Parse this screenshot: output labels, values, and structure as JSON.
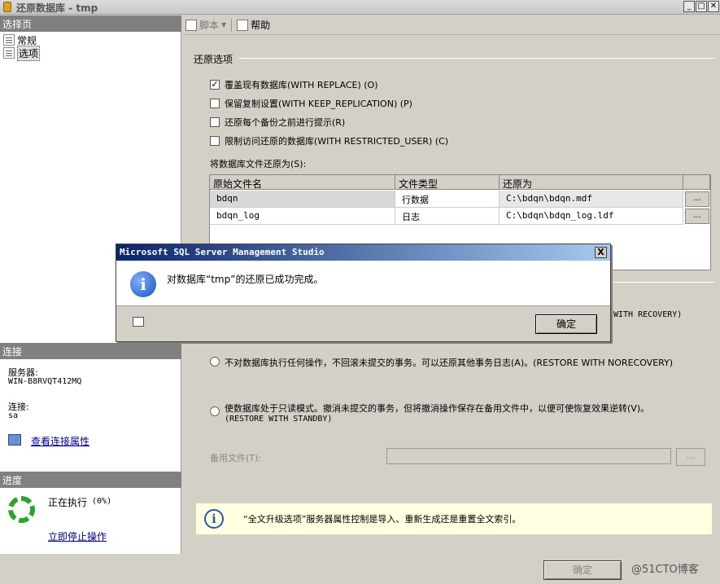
{
  "window": {
    "title": "还原数据库 - tmp"
  },
  "left": {
    "select_page_header": "选择页",
    "nav": [
      {
        "label": "常规"
      },
      {
        "label": "选项"
      }
    ],
    "connection_header": "连接",
    "server_label": "服务器:",
    "server_value": "WIN-B8RVQT412MQ",
    "conn_label": "连接:",
    "conn_value": "sa",
    "view_conn_link": "查看连接属性",
    "progress_header": "进度",
    "progress_status": "正在执行",
    "progress_pct": "(0%)",
    "stop_link": "立即停止操作"
  },
  "toolbar": {
    "script_label": "脚本",
    "help_label": "帮助"
  },
  "options": {
    "group_label": "还原选项",
    "checks": [
      {
        "label": "覆盖现有数据库(WITH REPLACE) (O)",
        "checked": true
      },
      {
        "label": "保留复制设置(WITH KEEP_REPLICATION) (P)",
        "checked": false
      },
      {
        "label": "还原每个备份之前进行提示(R)",
        "checked": false
      },
      {
        "label": "限制访问还原的数据库(WITH RESTRICTED_USER) (C)",
        "checked": false
      }
    ],
    "restore_as_label": "将数据库文件还原为(S):"
  },
  "grid": {
    "headers": [
      "原始文件名",
      "文件类型",
      "还原为"
    ],
    "rows": [
      {
        "orig": "bdqn",
        "type": "行数据",
        "restore_to": "C:\\bdqn\\bdqn.mdf"
      },
      {
        "orig": "bdqn_log",
        "type": "日志",
        "restore_to": "C:\\bdqn\\bdqn_log.ldf"
      }
    ],
    "ellipsis": "..."
  },
  "recovery": {
    "partial_text": "WITH RECOVERY)",
    "norecovery_label": "不对数据库执行任何操作，不回滚未提交的事务。可以还原其他事务日志(A)。(RESTORE WITH NORECOVERY)",
    "standby_line1": "使数据库处于只读模式。撤消未提交的事务，但将撤消操作保存在备用文件中，以便可使恢复效果逆转(V)。",
    "standby_line2": "(RESTORE WITH STANDBY)",
    "standby_file_label": "备用文件(T):",
    "standby_btn": "..."
  },
  "info": {
    "icon_glyph": "i",
    "text": "“全文升级选项”服务器属性控制是导入、重新生成还是重置全文索引。"
  },
  "footer": {
    "ok_label": "确定",
    "watermark": "@51CTO博客"
  },
  "dialog": {
    "title": "Microsoft SQL Server Management Studio",
    "message": "对数据库“tmp”的还原已成功完成。",
    "ok_label": "确定",
    "close_glyph": "X",
    "icon_glyph": "i"
  }
}
